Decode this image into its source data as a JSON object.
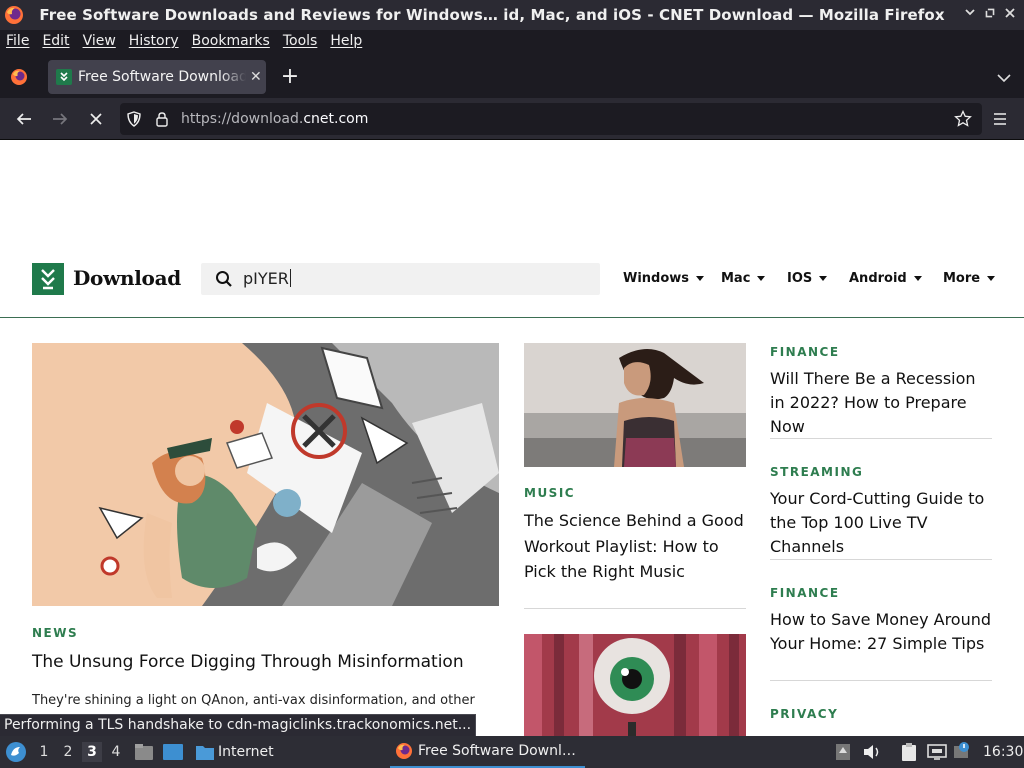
{
  "window": {
    "title": "Free Software Downloads and Reviews for Windows… id, Mac, and iOS - CNET Download — Mozilla Firefox"
  },
  "menubar": {
    "items": [
      "File",
      "Edit",
      "View",
      "History",
      "Bookmarks",
      "Tools",
      "Help"
    ]
  },
  "tabs": [
    {
      "label": "Free Software Downloads and Reviews for Windows"
    }
  ],
  "urlbar": {
    "prefix": "https://download.",
    "host": "cnet.com"
  },
  "site": {
    "logo_text": "Download",
    "search_value": "pIYER",
    "nav": [
      "Windows",
      "Mac",
      "IOS",
      "Android",
      "More"
    ]
  },
  "articles": {
    "hero": {
      "category": "NEWS",
      "headline": "The Unsung Force Digging Through Misinformation",
      "excerpt": "They're shining a light on QAnon, anti-vax disinformation, and other"
    },
    "mid": [
      {
        "category": "MUSIC",
        "headline": "The Science Behind a Good Workout Playlist: How to Pick the Right Music"
      }
    ],
    "side": [
      {
        "category": "FINANCE",
        "headline": "Will There Be a Recession in 2022? How to Prepare Now"
      },
      {
        "category": "STREAMING",
        "headline": "Your Cord-Cutting Guide to the Top 100 Live TV Channels"
      },
      {
        "category": "FINANCE",
        "headline": "How to Save Money Around Your Home: 27 Simple Tips"
      },
      {
        "category": "PRIVACY",
        "headline": ""
      }
    ]
  },
  "status": {
    "text": "Performing a TLS handshake to cdn-magiclinks.trackonomics.net..."
  },
  "taskbar": {
    "workspaces": [
      "1",
      "2",
      "3",
      "4"
    ],
    "active_workspace": "3",
    "launcher_label": "Internet",
    "task_label": "Free Software Downl…",
    "clock": "16:30"
  },
  "colors": {
    "brand_green": "#1f7a4b",
    "category_green": "#2e7d4f",
    "browser_dark": "#1c1b22",
    "toolbar": "#2b2a33"
  }
}
